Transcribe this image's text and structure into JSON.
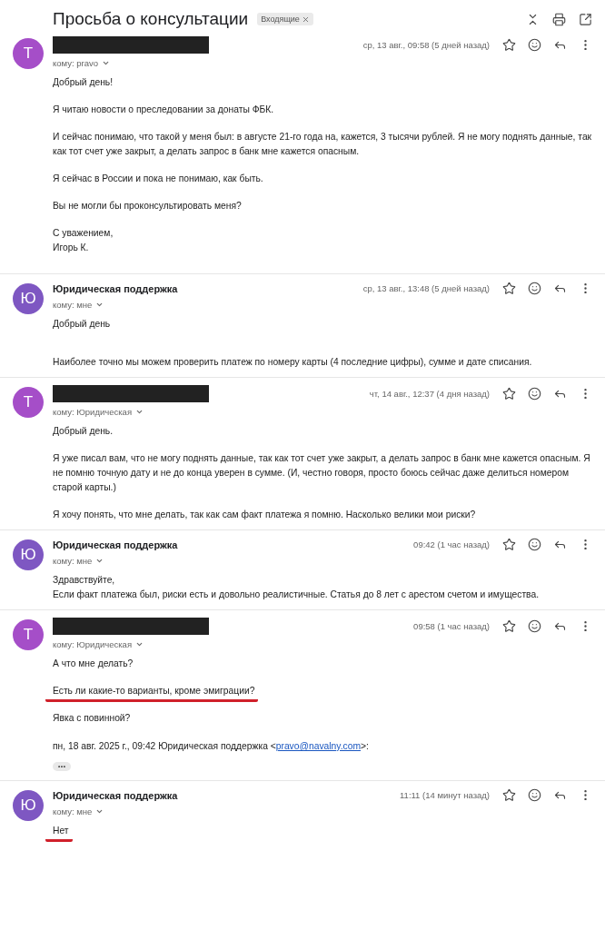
{
  "thread": {
    "subject": "Просьба о консультации",
    "label": "Входящие"
  },
  "messages": [
    {
      "avatar": "Т",
      "color": "#a54ec8",
      "sender_redacted": true,
      "recipient": "кому: pravo",
      "date": "ср, 13 авг., 09:58 (5 дней назад)",
      "paragraphs": [
        {
          "text": "Добрый день!",
          "kind": "plain"
        },
        {
          "text": "Я читаю новости о преследовании за донаты ФБК.",
          "kind": "plain"
        },
        {
          "text": "И сейчас понимаю, что такой у меня был: в августе 21-го года на, кажется, 3 тысячи рублей. Я не могу поднять данные, так как тот счет уже закрыт, а делать запрос в банк мне кажется опасным.",
          "kind": "plain"
        },
        {
          "text": "Я сейчас в России и пока не понимаю, как быть.",
          "kind": "plain"
        },
        {
          "text": "Вы не могли бы проконсультировать меня?",
          "kind": "plain"
        },
        {
          "text": "С уважением,\nИгорь К.",
          "kind": "plain"
        }
      ]
    },
    {
      "avatar": "Ю",
      "color": "#7e57c2",
      "sender": "Юридическая поддержка",
      "sender_redacted": false,
      "recipient": "кому: мне",
      "date": "ср, 13 авг., 13:48 (5 дней назад)",
      "paragraphs": [
        {
          "text": "Добрый день",
          "kind": "plain"
        },
        {
          "text": "Наиболее точно мы можем проверить платеж по номеру карты (4 последние цифры), сумме и дате списания.",
          "kind": "plain"
        }
      ]
    },
    {
      "avatar": "Т",
      "color": "#a54ec8",
      "sender_redacted": true,
      "recipient": "кому: Юридическая",
      "date": "чт, 14 авг., 12:37 (4 дня назад)",
      "paragraphs": [
        {
          "text": "Добрый день.",
          "kind": "plain"
        },
        {
          "text": "Я уже писал вам, что не могу поднять данные, так как тот счет уже закрыт, а делать запрос в банк мне кажется опасным. Я не помню точную дату и не до конца уверен в сумме. (И, честно говоря, просто боюсь сейчас даже делиться номером старой карты.)",
          "kind": "plain"
        },
        {
          "text": "Я хочу понять, что мне делать, так как сам факт платежа я помню. Насколько велики мои риски?",
          "kind": "plain"
        }
      ]
    },
    {
      "avatar": "Ю",
      "color": "#7e57c2",
      "sender": "Юридическая поддержка",
      "sender_redacted": false,
      "recipient": "кому: мне",
      "date": "09:42 (1 час назад)",
      "paragraphs": [
        {
          "text": "Здравствуйте,\nЕсли факт платежа был, риски есть и довольно реалистичные. Статья до 8 лет с арестом счетом и имущества.",
          "kind": "plain"
        }
      ]
    },
    {
      "avatar": "Т",
      "color": "#a54ec8",
      "sender_redacted": true,
      "recipient": "кому: Юридическая",
      "date": "09:58 (1 час назад)",
      "paragraphs": [
        {
          "text": "А что мне делать?",
          "kind": "plain"
        },
        {
          "text": "Есть ли какие-то варианты, кроме эмиграции?",
          "kind": "underlined"
        },
        {
          "text": "Явка с повинной?",
          "kind": "plain"
        }
      ],
      "quote": {
        "before": "пн, 18 авг. 2025 г., 09:42 Юридическая поддержка <",
        "link": "pravo@navalny.com",
        "after": ">:"
      }
    },
    {
      "avatar": "Ю",
      "color": "#7e57c2",
      "sender": "Юридическая поддержка",
      "sender_redacted": false,
      "recipient": "кому: мне",
      "date": "11:11 (14 минут назад)",
      "paragraphs": [
        {
          "text": "Нет",
          "kind": "underlined"
        }
      ]
    }
  ]
}
